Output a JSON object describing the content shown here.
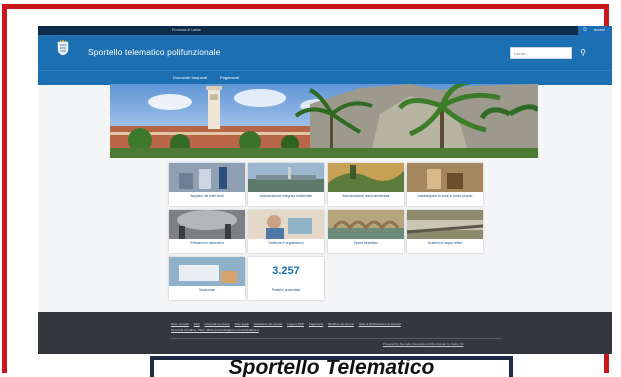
{
  "topbar": {
    "province": "Provincia di Latina",
    "login_label": "Accedi"
  },
  "header": {
    "title": "Sportello telematico polifunzionale",
    "search_placeholder": "Cerca...",
    "search_icon": "search-icon"
  },
  "nav": {
    "items": [
      "Domande frequenti",
      "Pagamenti"
    ]
  },
  "tiles": [
    {
      "label": "Acquisto dei tratti verdi"
    },
    {
      "label": "Autorizzazione integrata ambientale"
    },
    {
      "label": "Autorizzazione unica ambientale"
    },
    {
      "label": "Autotrasporto di cose in conto proprio"
    },
    {
      "label": "Emissioni in atmosfera"
    },
    {
      "label": "Gestione e segnalazioni"
    },
    {
      "label": "Opere idrauliche"
    },
    {
      "label": "Scarichi di acque reflue"
    },
    {
      "label": "Sanzionale"
    },
    {
      "label": "Pratiche presentate",
      "value": "3.257"
    }
  ],
  "footer": {
    "links": [
      "Note correlati",
      "FAQ",
      "Informativa privacy",
      "Note legali",
      "Statistiche del portale",
      "Leggi e PNP",
      "Pagamenti",
      "Modifica documenti",
      "Note di dichiarazione di accessi"
    ],
    "links2": "Provincia di Latina - PEC: ufficio.protocollo@pec.provincia.latina.it",
    "powered": "Powered by Sportello Telematico Polifunzionale by Globo Srl"
  },
  "caption": "Sportello Telematico"
}
